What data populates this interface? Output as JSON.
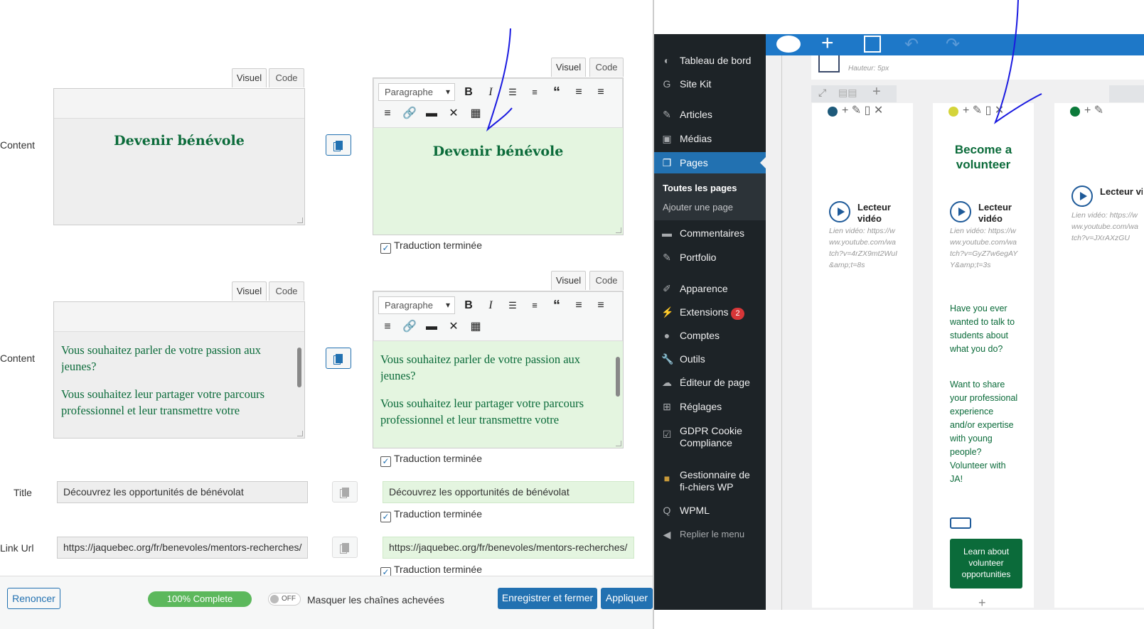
{
  "editor": {
    "tabs": {
      "visual": "Visuel",
      "code": "Code"
    },
    "toolbar": {
      "format": "Paragraphe"
    },
    "rows": [
      {
        "label": "Content",
        "original": "Devenir bénévole",
        "translation": "Devenir bénévole",
        "done": "Traduction terminée"
      },
      {
        "label": "Content",
        "original_p1": "Vous souhaitez parler de votre passion aux jeunes?",
        "original_p2": "Vous souhaitez leur partager votre parcours professionnel et leur transmettre votre",
        "translation_p1": "Vous souhaitez parler de votre passion aux jeunes?",
        "translation_p2": "Vous souhaitez leur partager votre parcours professionnel et leur transmettre votre",
        "done": "Traduction terminée"
      },
      {
        "label": "Title",
        "original": "Découvrez les opportunités de bénévolat",
        "translation": "Découvrez les opportunités de bénévolat",
        "done": "Traduction terminée"
      },
      {
        "label": "Link Url",
        "original": "https://jaquebec.org/fr/benevoles/mentors-recherches/",
        "translation": "https://jaquebec.org/fr/benevoles/mentors-recherches/",
        "done": "Traduction terminée"
      }
    ],
    "footer": {
      "cancel": "Renoncer",
      "progress": "100% Complete",
      "progress_value": 100,
      "toggle": "OFF",
      "hide_label": "Masquer les chaînes achevées",
      "save_close": "Enregistrer et fermer",
      "apply": "Appliquer"
    }
  },
  "wp": {
    "menu": [
      {
        "label": "Tableau de bord",
        "icon": "dashboard-icon"
      },
      {
        "label": "Site Kit",
        "icon": "google-icon"
      },
      {
        "label": "Articles",
        "icon": "pin-icon"
      },
      {
        "label": "Médias",
        "icon": "media-icon"
      },
      {
        "label": "Pages",
        "icon": "pages-icon"
      },
      {
        "label": "Commentaires",
        "icon": "comments-icon"
      },
      {
        "label": "Portfolio",
        "icon": "pin-icon"
      },
      {
        "label": "Apparence",
        "icon": "brush-icon"
      },
      {
        "label": "Extensions",
        "icon": "plugin-icon",
        "badge": "2"
      },
      {
        "label": "Comptes",
        "icon": "user-icon"
      },
      {
        "label": "Outils",
        "icon": "wrench-icon"
      },
      {
        "label": "Éditeur de page",
        "icon": "cloud-icon"
      },
      {
        "label": "Réglages",
        "icon": "settings-icon"
      },
      {
        "label": "GDPR Cookie Compliance",
        "icon": "check-icon"
      },
      {
        "label": "Gestionnaire de fi-chiers WP",
        "icon": "folder-icon"
      },
      {
        "label": "WPML",
        "icon": "wpml-icon"
      },
      {
        "label": "Replier le menu",
        "icon": "collapse-icon"
      }
    ],
    "submenu": [
      "Toutes les pages",
      "Ajouter une page"
    ],
    "builder": {
      "spacer": "Hauteur: 5px",
      "columns": [
        {
          "video_label": "Lecteur vidéo",
          "video_hint": "Lien vidéo:",
          "video_url": "https://www.youtube.com/watch?v=4rZX9mt2WuI&amp;t=8s",
          "dot": "#1e5a7a"
        },
        {
          "heading": "Become a volunteer",
          "video_label": "Lecteur vidéo",
          "video_hint": "Lien vidéo:",
          "video_url": "https://www.youtube.com/watch?v=GyZ7w6egAYY&amp;t=3s",
          "dot": "#d4d43a",
          "text1": "Have you ever wanted to talk to students about what you do?",
          "text2": "Want to share your professional experience and/or expertise with young people? Volunteer with JA!",
          "button": "Learn about volunteer opportunities"
        },
        {
          "video_label": "Lecteur vidéo",
          "video_hint": "Lien vidéo:",
          "video_url": "https://www.youtube.com/watch?v=JXrAXzGU",
          "dot": "#0b7a3a"
        }
      ]
    }
  }
}
